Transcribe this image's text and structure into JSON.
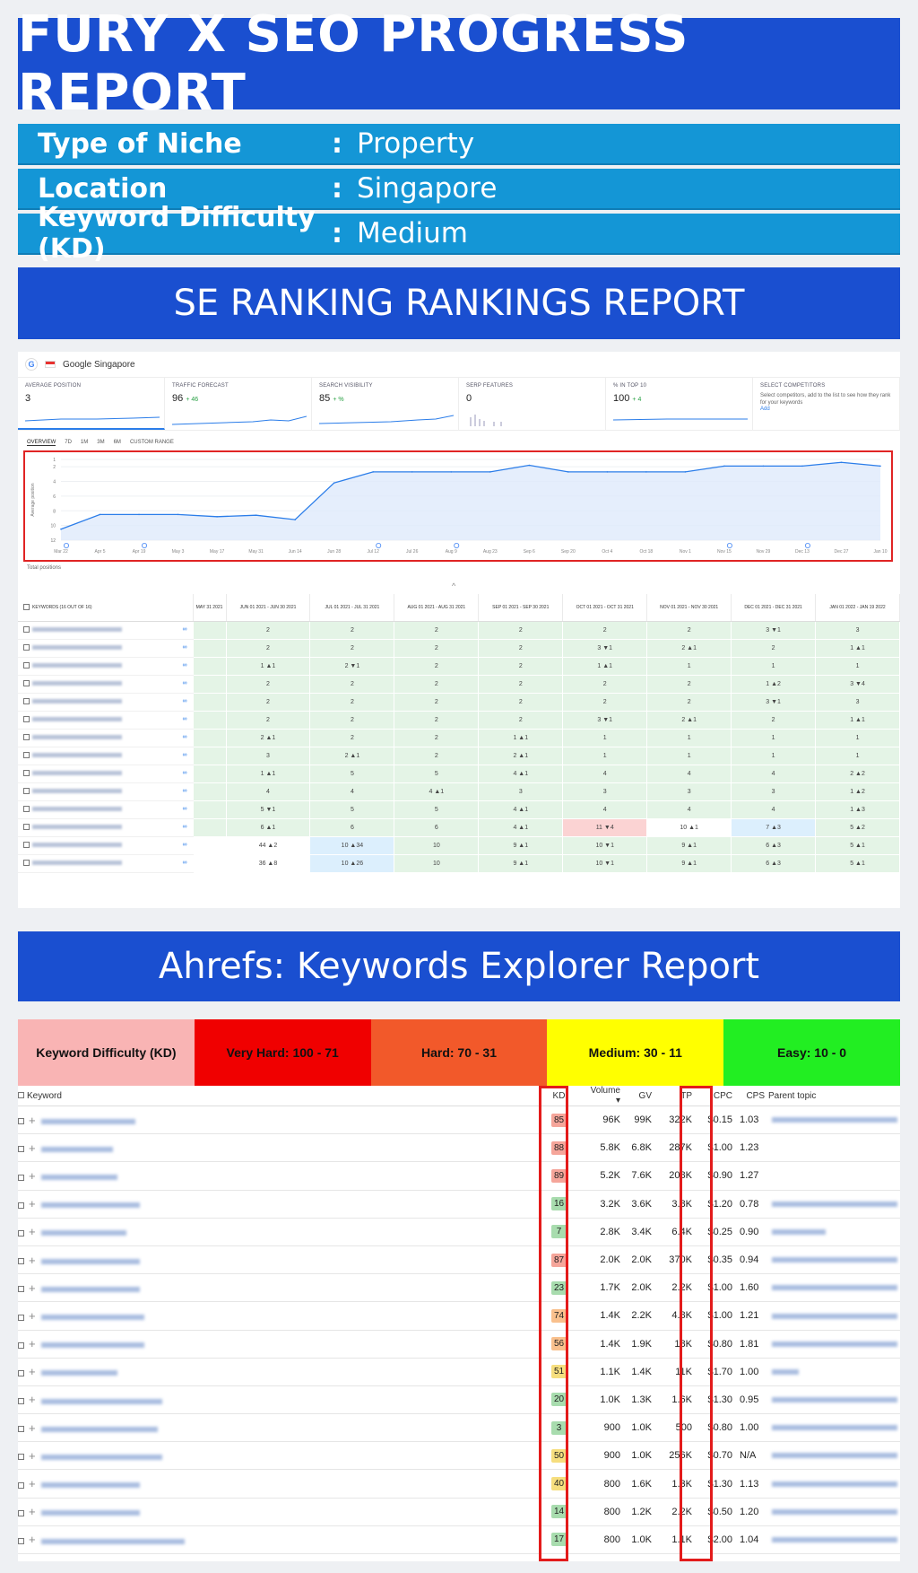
{
  "header": {
    "title": "FURY X SEO PROGRESS REPORT"
  },
  "info": [
    {
      "label": "Type of Niche",
      "colon": ":",
      "value": "Property"
    },
    {
      "label": "Location",
      "colon": ":",
      "value": "Singapore"
    },
    {
      "label": "Keyword Difficulty (KD)",
      "colon": ":",
      "value": "Medium"
    }
  ],
  "se_ranking": {
    "banner": "SE RANKING RANKINGS REPORT",
    "engine_label": "Google Singapore",
    "metrics": [
      {
        "title": "AVERAGE POSITION",
        "value": "3",
        "delta": ""
      },
      {
        "title": "TRAFFIC FORECAST",
        "value": "96",
        "delta": "+ 46"
      },
      {
        "title": "SEARCH VISIBILITY",
        "value": "85",
        "delta": "+ %"
      },
      {
        "title": "SERP FEATURES",
        "value": "0",
        "delta": ""
      },
      {
        "title": "% IN TOP 10",
        "value": "100",
        "delta": "+ 4"
      },
      {
        "title": "SELECT COMPETITORS",
        "value": "",
        "delta": "",
        "desc": "Select competitors, add to the list to see how they rank for your keywords",
        "link": "Add"
      }
    ],
    "tabs": [
      "OVERVIEW",
      "7D",
      "1M",
      "3M",
      "6M",
      "CUSTOM RANGE"
    ],
    "chart_data": {
      "type": "line",
      "title": "",
      "ylabel": "Average position",
      "x": [
        "Mar 22",
        "Apr 5",
        "Apr 19",
        "May 3",
        "May 17",
        "May 31",
        "Jun 14",
        "Jun 28",
        "Jul 12",
        "Jul 26",
        "Aug 9",
        "Aug 23",
        "Sep 6",
        "Sep 20",
        "Oct 4",
        "Oct 18",
        "Nov 1",
        "Nov 15",
        "Nov 29",
        "Dec 13",
        "Dec 27",
        "Jan 10"
      ],
      "y_ticks": [
        "1",
        "2",
        "4",
        "6",
        "8",
        "10",
        "12"
      ],
      "ylim": [
        12,
        1
      ],
      "series": [
        {
          "name": "",
          "values": [
            10.5,
            8.5,
            8.5,
            8.5,
            8.8,
            8.6,
            9.2,
            4.2,
            2.7,
            2.7,
            2.7,
            2.7,
            1.8,
            2.7,
            2.7,
            2.7,
            2.7,
            1.9,
            1.9,
            1.9,
            1.4,
            1.9
          ]
        }
      ],
      "legend_note": "Total positions"
    },
    "table": {
      "kw_header": "KEYWORDS (16 OUT OF 16)",
      "columns": [
        "MAY 31 2021",
        "JUN 01 2021 - JUN 30 2021",
        "JUL 01 2021 - JUL 31 2021",
        "AUG 01 2021 - AUG 31 2021",
        "SEP 01 2021 - SEP 30 2021",
        "OCT 01 2021 - OCT 31 2021",
        "NOV 01 2021 - NOV 30 2021",
        "DEC 01 2021 - DEC 31 2021",
        "JAN 01 2022 - JAN 19 2022"
      ],
      "rows": [
        [
          "",
          "2",
          "2",
          "2",
          "2",
          "2",
          "2",
          "3 ▼1",
          "3"
        ],
        [
          "",
          "2",
          "2",
          "2",
          "2",
          "3 ▼1",
          "2 ▲1",
          "2",
          "1 ▲1"
        ],
        [
          "",
          "1 ▲1",
          "2 ▼1",
          "2",
          "2",
          "1 ▲1",
          "1",
          "1",
          "1"
        ],
        [
          "",
          "2",
          "2",
          "2",
          "2",
          "2",
          "2",
          "1 ▲2",
          "3 ▼4"
        ],
        [
          "",
          "2",
          "2",
          "2",
          "2",
          "2",
          "2",
          "3 ▼1",
          "3"
        ],
        [
          "",
          "2",
          "2",
          "2",
          "2",
          "3 ▼1",
          "2 ▲1",
          "2",
          "1 ▲1"
        ],
        [
          "",
          "2 ▲1",
          "2",
          "2",
          "1 ▲1",
          "1",
          "1",
          "1",
          "1"
        ],
        [
          "",
          "3",
          "2 ▲1",
          "2",
          "2 ▲1",
          "1",
          "1",
          "1",
          "1"
        ],
        [
          "",
          "1 ▲1",
          "5",
          "5",
          "4 ▲1",
          "4",
          "4",
          "4",
          "2 ▲2"
        ],
        [
          "",
          "4",
          "4",
          "4 ▲1",
          "3",
          "3",
          "3",
          "3",
          "1 ▲2"
        ],
        [
          "",
          "5 ▼1",
          "5",
          "5",
          "4 ▲1",
          "4",
          "4",
          "4",
          "1 ▲3"
        ],
        [
          "",
          "6 ▲1",
          "6",
          "6",
          "4 ▲1",
          "11 ▼4",
          "10 ▲1",
          "7 ▲3",
          "5 ▲2"
        ],
        [
          "",
          "44 ▲2",
          "10 ▲34",
          "10",
          "9 ▲1",
          "10 ▼1",
          "9 ▲1",
          "6 ▲3",
          "5 ▲1"
        ],
        [
          "",
          "36 ▲8",
          "10 ▲26",
          "10",
          "9 ▲1",
          "10 ▼1",
          "9 ▲1",
          "6 ▲3",
          "5 ▲1"
        ]
      ],
      "row_colors": [
        [
          "g",
          "g",
          "g",
          "g",
          "g",
          "g",
          "g",
          "g",
          "g"
        ],
        [
          "g",
          "g",
          "g",
          "g",
          "g",
          "g",
          "g",
          "g",
          "g"
        ],
        [
          "g",
          "g",
          "g",
          "g",
          "g",
          "g",
          "g",
          "g",
          "g"
        ],
        [
          "g",
          "g",
          "g",
          "g",
          "g",
          "g",
          "g",
          "g",
          "g"
        ],
        [
          "g",
          "g",
          "g",
          "g",
          "g",
          "g",
          "g",
          "g",
          "g"
        ],
        [
          "g",
          "g",
          "g",
          "g",
          "g",
          "g",
          "g",
          "g",
          "g"
        ],
        [
          "g",
          "g",
          "g",
          "g",
          "g",
          "g",
          "g",
          "g",
          "g"
        ],
        [
          "g",
          "g",
          "g",
          "g",
          "g",
          "g",
          "g",
          "g",
          "g"
        ],
        [
          "g",
          "g",
          "g",
          "g",
          "g",
          "g",
          "g",
          "g",
          "g"
        ],
        [
          "g",
          "g",
          "g",
          "g",
          "g",
          "g",
          "g",
          "g",
          "g"
        ],
        [
          "g",
          "g",
          "g",
          "g",
          "g",
          "g",
          "g",
          "g",
          "g"
        ],
        [
          "g",
          "g",
          "g",
          "g",
          "g",
          "r",
          "w",
          "b",
          "g"
        ],
        [
          "w",
          "w",
          "b",
          "g",
          "g",
          "g",
          "g",
          "g",
          "g"
        ],
        [
          "w",
          "w",
          "b",
          "g",
          "g",
          "g",
          "g",
          "g",
          "g"
        ]
      ]
    }
  },
  "ahrefs": {
    "banner": "Ahrefs: Keywords Explorer Report",
    "kd_legend": [
      {
        "label": "Keyword Difficulty (KD)",
        "color": "#f9b4b4"
      },
      {
        "label": "Very Hard: 100 - 71",
        "color": "#f00000"
      },
      {
        "label": "Hard: 70 - 31",
        "color": "#f2592a"
      },
      {
        "label": "Medium: 30 - 11",
        "color": "#ffff00"
      },
      {
        "label": "Easy: 10 - 0",
        "color": "#22ee22"
      }
    ],
    "columns": {
      "keyword": "Keyword",
      "kd": "KD",
      "volume": "Volume ▾",
      "gv": "GV",
      "tp": "TP",
      "cpc": "CPC",
      "cps": "CPS",
      "parent": "Parent topic"
    },
    "rows": [
      {
        "kd": "85",
        "kdc": "kd-red",
        "volume": "96K",
        "gv": "99K",
        "tp": "322K",
        "cpc": "$0.15",
        "cps": "1.03"
      },
      {
        "kd": "88",
        "kdc": "kd-red",
        "volume": "5.8K",
        "gv": "6.8K",
        "tp": "287K",
        "cpc": "$1.00",
        "cps": "1.23"
      },
      {
        "kd": "89",
        "kdc": "kd-red",
        "volume": "5.2K",
        "gv": "7.6K",
        "tp": "208K",
        "cpc": "$0.90",
        "cps": "1.27"
      },
      {
        "kd": "16",
        "kdc": "kd-grn",
        "volume": "3.2K",
        "gv": "3.6K",
        "tp": "3.8K",
        "cpc": "$1.20",
        "cps": "0.78"
      },
      {
        "kd": "7",
        "kdc": "kd-grn",
        "volume": "2.8K",
        "gv": "3.4K",
        "tp": "6.4K",
        "cpc": "$0.25",
        "cps": "0.90"
      },
      {
        "kd": "87",
        "kdc": "kd-red",
        "volume": "2.0K",
        "gv": "2.0K",
        "tp": "370K",
        "cpc": "$0.35",
        "cps": "0.94"
      },
      {
        "kd": "23",
        "kdc": "kd-grn",
        "volume": "1.7K",
        "gv": "2.0K",
        "tp": "2.2K",
        "cpc": "$1.00",
        "cps": "1.60"
      },
      {
        "kd": "74",
        "kdc": "kd-or",
        "volume": "1.4K",
        "gv": "2.2K",
        "tp": "4.8K",
        "cpc": "$1.00",
        "cps": "1.21"
      },
      {
        "kd": "56",
        "kdc": "kd-or",
        "volume": "1.4K",
        "gv": "1.9K",
        "tp": "18K",
        "cpc": "$0.80",
        "cps": "1.81"
      },
      {
        "kd": "51",
        "kdc": "kd-yel",
        "volume": "1.1K",
        "gv": "1.4K",
        "tp": "11K",
        "cpc": "$1.70",
        "cps": "1.00"
      },
      {
        "kd": "20",
        "kdc": "kd-grn",
        "volume": "1.0K",
        "gv": "1.3K",
        "tp": "1.6K",
        "cpc": "$1.30",
        "cps": "0.95"
      },
      {
        "kd": "3",
        "kdc": "kd-grn",
        "volume": "900",
        "gv": "1.0K",
        "tp": "500",
        "cpc": "$0.80",
        "cps": "1.00"
      },
      {
        "kd": "50",
        "kdc": "kd-yel",
        "volume": "900",
        "gv": "1.0K",
        "tp": "256K",
        "cpc": "$0.70",
        "cps": "N/A"
      },
      {
        "kd": "40",
        "kdc": "kd-yel",
        "volume": "800",
        "gv": "1.6K",
        "tp": "1.3K",
        "cpc": "$1.30",
        "cps": "1.13"
      },
      {
        "kd": "14",
        "kdc": "kd-grn",
        "volume": "800",
        "gv": "1.2K",
        "tp": "2.2K",
        "cpc": "$0.50",
        "cps": "1.20"
      },
      {
        "kd": "17",
        "kdc": "kd-grn",
        "volume": "800",
        "gv": "1.0K",
        "tp": "1.1K",
        "cpc": "$2.00",
        "cps": "1.04"
      }
    ]
  }
}
